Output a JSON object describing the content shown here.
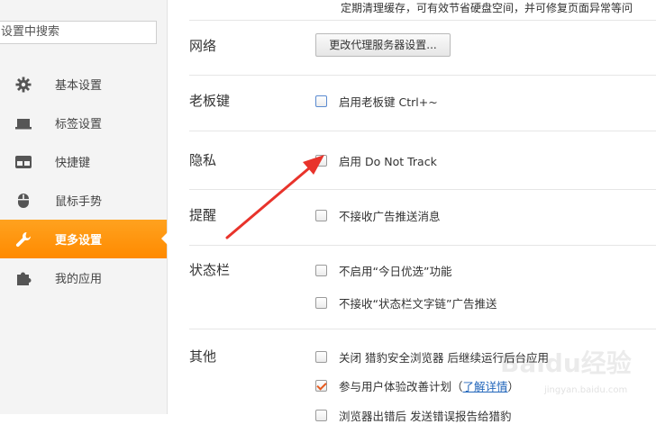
{
  "search": {
    "placeholder": "设置中搜索"
  },
  "sidebar": {
    "items": [
      {
        "label": "基本设置",
        "icon": "gear-icon"
      },
      {
        "label": "标签设置",
        "icon": "tab-icon"
      },
      {
        "label": "快捷键",
        "icon": "keyboard-icon"
      },
      {
        "label": "鼠标手势",
        "icon": "mouse-icon"
      },
      {
        "label": "更多设置",
        "icon": "wrench-icon",
        "active": true
      },
      {
        "label": "我的应用",
        "icon": "puzzle-icon"
      }
    ],
    "active_color": "#ff8a00"
  },
  "main": {
    "top_desc": "定期清理缓存，可有效节省硬盘空间，并可修复页面异常等问",
    "network": {
      "title": "网络",
      "button_label": "更改代理服务器设置..."
    },
    "boss_key": {
      "title": "老板键",
      "option": "启用老板键   Ctrl+~",
      "checked": false
    },
    "privacy": {
      "title": "隐私",
      "option": "启用 Do Not Track",
      "checked": false
    },
    "reminder": {
      "title": "提醒",
      "option": "不接收广告推送消息",
      "checked": false
    },
    "statusbar": {
      "title": "状态栏",
      "options": [
        {
          "label": "不启用“今日优选”功能",
          "checked": false
        },
        {
          "label": "不接收“状态栏文字链”广告推送",
          "checked": false
        }
      ]
    },
    "other": {
      "title": "其他",
      "options": [
        {
          "label": "关闭 猎豹安全浏览器 后继续运行后台应用",
          "checked": false
        },
        {
          "label": "参与用户体验改善计划（",
          "link": "了解详情",
          "suffix": "）",
          "checked": true
        },
        {
          "label": "浏览器出错后 发送错误报告给猎豹",
          "checked": false
        }
      ]
    }
  },
  "annotation": {
    "arrow_color": "#e8332b"
  },
  "watermark": {
    "text": "Baidu经验",
    "sub": "jingyan.baidu.com"
  }
}
